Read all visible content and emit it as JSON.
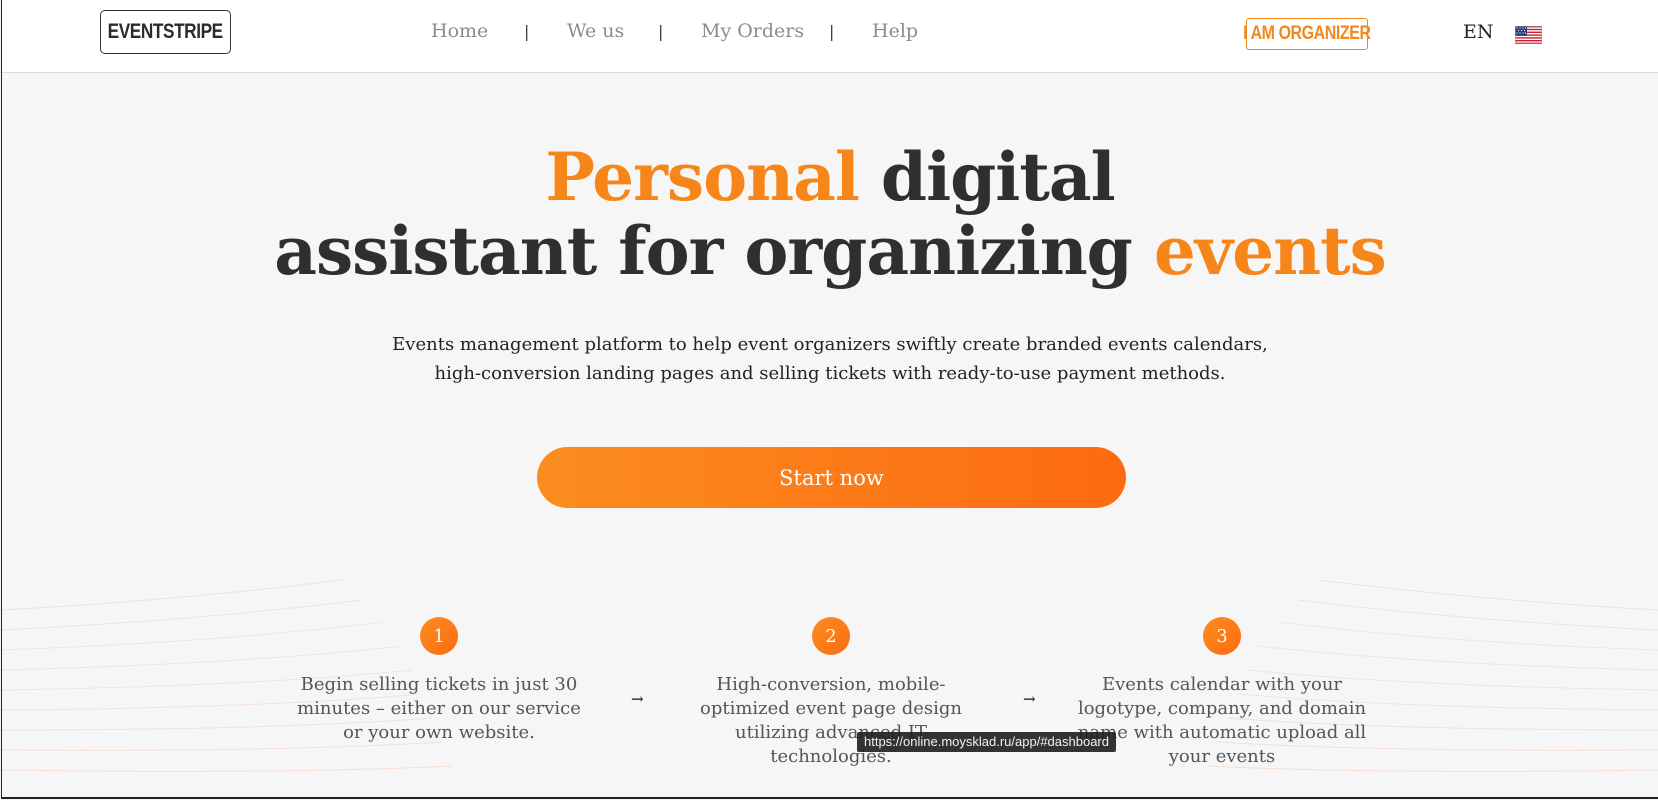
{
  "header": {
    "logo": "EVENTSTRIPE",
    "nav": [
      "Home",
      "We us",
      "My Orders",
      "Help"
    ],
    "separator": "|",
    "organizer_button": "I AM ORGANIZER",
    "language": "EN",
    "flag_icon": "us-flag-icon"
  },
  "hero": {
    "headline_line1_accent": "Personal",
    "headline_line1_rest": " digital",
    "headline_line2_rest": "assistant for organizing ",
    "headline_line2_accent": "events",
    "subtitle_line1": "Events management platform to help event organizers swiftly create branded events calendars,",
    "subtitle_line2": "high-conversion landing pages and selling tickets with ready-to-use payment methods.",
    "cta_label": "Start now"
  },
  "steps": [
    {
      "number": "1",
      "text": "Begin selling tickets in just 30 minutes – either on our service or your own website."
    },
    {
      "number": "2",
      "text": "High-conversion, mobile-optimized event page design utilizing advanced IT technologies."
    },
    {
      "number": "3",
      "text": "Events calendar with your logotype, company, and domain name with automatic upload all your events"
    }
  ],
  "arrow_glyph": "→",
  "status_tooltip": "https://online.moysklad.ru/app/#dashboard",
  "colors": {
    "accent": "#f7861a",
    "cta_gradient_start": "#fb8d1f",
    "cta_gradient_end": "#fd6a12",
    "text_dark": "#2f2f2f",
    "nav_text": "#8c8c8c"
  }
}
